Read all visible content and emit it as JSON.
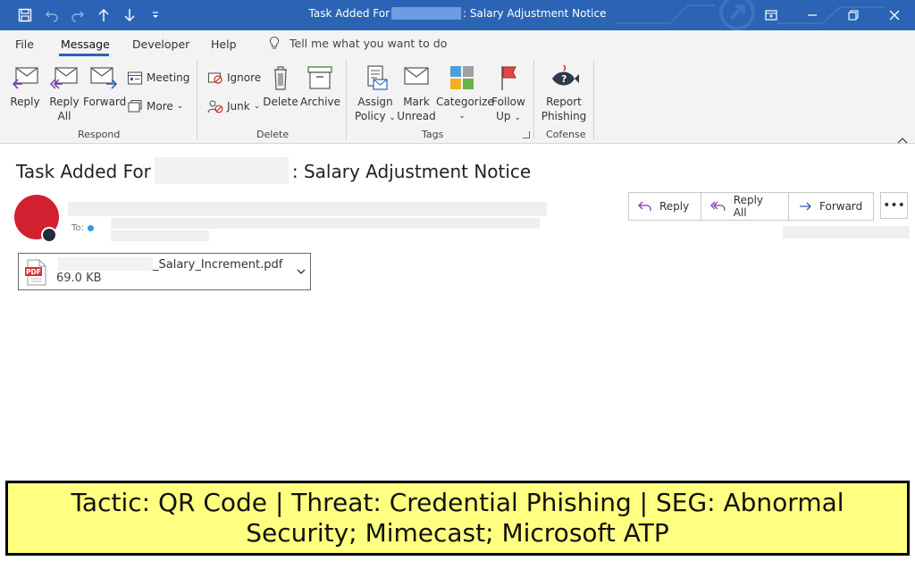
{
  "window": {
    "title_prefix": "Task Added For",
    "title_suffix": ": Salary Adjustment Notice"
  },
  "menu": {
    "file": "File",
    "message": "Message",
    "developer": "Developer",
    "help": "Help",
    "tell_me": "Tell me what you want to do"
  },
  "ribbon": {
    "respond": {
      "group": "Respond",
      "reply": "Reply",
      "reply_all_1": "Reply",
      "reply_all_2": "All",
      "forward": "Forward",
      "meeting": "Meeting",
      "more": "More"
    },
    "delete": {
      "group": "Delete",
      "ignore": "Ignore",
      "junk": "Junk",
      "delete": "Delete",
      "archive": "Archive"
    },
    "tags": {
      "group": "Tags",
      "assign_1": "Assign",
      "assign_2": "Policy",
      "mark_1": "Mark",
      "mark_2": "Unread",
      "categorize": "Categorize",
      "follow_1": "Follow",
      "follow_2": "Up"
    },
    "cofense": {
      "group": "Cofense",
      "report_1": "Report",
      "report_2": "Phishing"
    }
  },
  "message": {
    "subject_prefix": "Task Added For",
    "subject_suffix": ": Salary Adjustment Notice",
    "to_label": "To:",
    "actions": {
      "reply": "Reply",
      "reply_all": "Reply All",
      "forward": "Forward",
      "more": "•••"
    },
    "attachment": {
      "name_suffix": "_Salary_Increment.pdf",
      "size": "69.0 KB",
      "badge": "PDF"
    }
  },
  "banner": {
    "text": "Tactic: QR Code | Threat: Credential Phishing | SEG: Abnormal Security; Mimecast; Microsoft ATP"
  },
  "colors": {
    "titlebar": "#2b64b4",
    "avatar": "#d12030",
    "banner_bg": "#ffff80"
  }
}
